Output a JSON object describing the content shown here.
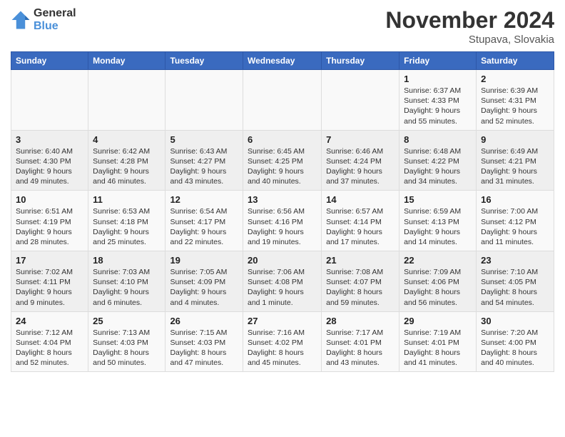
{
  "header": {
    "logo_line1": "General",
    "logo_line2": "Blue",
    "month": "November 2024",
    "location": "Stupava, Slovakia"
  },
  "days_of_week": [
    "Sunday",
    "Monday",
    "Tuesday",
    "Wednesday",
    "Thursday",
    "Friday",
    "Saturday"
  ],
  "weeks": [
    [
      {
        "day": "",
        "info": ""
      },
      {
        "day": "",
        "info": ""
      },
      {
        "day": "",
        "info": ""
      },
      {
        "day": "",
        "info": ""
      },
      {
        "day": "",
        "info": ""
      },
      {
        "day": "1",
        "info": "Sunrise: 6:37 AM\nSunset: 4:33 PM\nDaylight: 9 hours and 55 minutes."
      },
      {
        "day": "2",
        "info": "Sunrise: 6:39 AM\nSunset: 4:31 PM\nDaylight: 9 hours and 52 minutes."
      }
    ],
    [
      {
        "day": "3",
        "info": "Sunrise: 6:40 AM\nSunset: 4:30 PM\nDaylight: 9 hours and 49 minutes."
      },
      {
        "day": "4",
        "info": "Sunrise: 6:42 AM\nSunset: 4:28 PM\nDaylight: 9 hours and 46 minutes."
      },
      {
        "day": "5",
        "info": "Sunrise: 6:43 AM\nSunset: 4:27 PM\nDaylight: 9 hours and 43 minutes."
      },
      {
        "day": "6",
        "info": "Sunrise: 6:45 AM\nSunset: 4:25 PM\nDaylight: 9 hours and 40 minutes."
      },
      {
        "day": "7",
        "info": "Sunrise: 6:46 AM\nSunset: 4:24 PM\nDaylight: 9 hours and 37 minutes."
      },
      {
        "day": "8",
        "info": "Sunrise: 6:48 AM\nSunset: 4:22 PM\nDaylight: 9 hours and 34 minutes."
      },
      {
        "day": "9",
        "info": "Sunrise: 6:49 AM\nSunset: 4:21 PM\nDaylight: 9 hours and 31 minutes."
      }
    ],
    [
      {
        "day": "10",
        "info": "Sunrise: 6:51 AM\nSunset: 4:19 PM\nDaylight: 9 hours and 28 minutes."
      },
      {
        "day": "11",
        "info": "Sunrise: 6:53 AM\nSunset: 4:18 PM\nDaylight: 9 hours and 25 minutes."
      },
      {
        "day": "12",
        "info": "Sunrise: 6:54 AM\nSunset: 4:17 PM\nDaylight: 9 hours and 22 minutes."
      },
      {
        "day": "13",
        "info": "Sunrise: 6:56 AM\nSunset: 4:16 PM\nDaylight: 9 hours and 19 minutes."
      },
      {
        "day": "14",
        "info": "Sunrise: 6:57 AM\nSunset: 4:14 PM\nDaylight: 9 hours and 17 minutes."
      },
      {
        "day": "15",
        "info": "Sunrise: 6:59 AM\nSunset: 4:13 PM\nDaylight: 9 hours and 14 minutes."
      },
      {
        "day": "16",
        "info": "Sunrise: 7:00 AM\nSunset: 4:12 PM\nDaylight: 9 hours and 11 minutes."
      }
    ],
    [
      {
        "day": "17",
        "info": "Sunrise: 7:02 AM\nSunset: 4:11 PM\nDaylight: 9 hours and 9 minutes."
      },
      {
        "day": "18",
        "info": "Sunrise: 7:03 AM\nSunset: 4:10 PM\nDaylight: 9 hours and 6 minutes."
      },
      {
        "day": "19",
        "info": "Sunrise: 7:05 AM\nSunset: 4:09 PM\nDaylight: 9 hours and 4 minutes."
      },
      {
        "day": "20",
        "info": "Sunrise: 7:06 AM\nSunset: 4:08 PM\nDaylight: 9 hours and 1 minute."
      },
      {
        "day": "21",
        "info": "Sunrise: 7:08 AM\nSunset: 4:07 PM\nDaylight: 8 hours and 59 minutes."
      },
      {
        "day": "22",
        "info": "Sunrise: 7:09 AM\nSunset: 4:06 PM\nDaylight: 8 hours and 56 minutes."
      },
      {
        "day": "23",
        "info": "Sunrise: 7:10 AM\nSunset: 4:05 PM\nDaylight: 8 hours and 54 minutes."
      }
    ],
    [
      {
        "day": "24",
        "info": "Sunrise: 7:12 AM\nSunset: 4:04 PM\nDaylight: 8 hours and 52 minutes."
      },
      {
        "day": "25",
        "info": "Sunrise: 7:13 AM\nSunset: 4:03 PM\nDaylight: 8 hours and 50 minutes."
      },
      {
        "day": "26",
        "info": "Sunrise: 7:15 AM\nSunset: 4:03 PM\nDaylight: 8 hours and 47 minutes."
      },
      {
        "day": "27",
        "info": "Sunrise: 7:16 AM\nSunset: 4:02 PM\nDaylight: 8 hours and 45 minutes."
      },
      {
        "day": "28",
        "info": "Sunrise: 7:17 AM\nSunset: 4:01 PM\nDaylight: 8 hours and 43 minutes."
      },
      {
        "day": "29",
        "info": "Sunrise: 7:19 AM\nSunset: 4:01 PM\nDaylight: 8 hours and 41 minutes."
      },
      {
        "day": "30",
        "info": "Sunrise: 7:20 AM\nSunset: 4:00 PM\nDaylight: 8 hours and 40 minutes."
      }
    ]
  ]
}
